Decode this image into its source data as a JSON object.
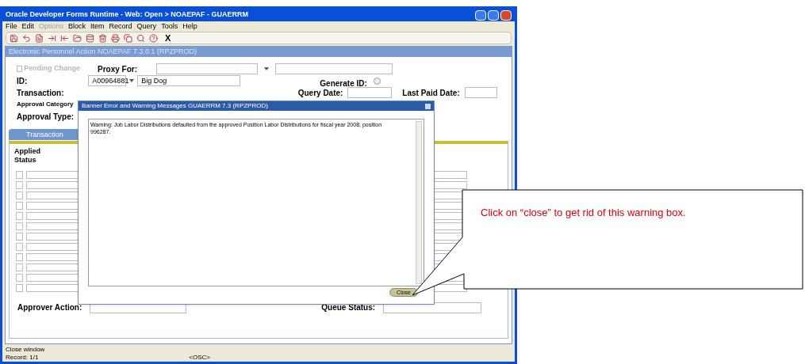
{
  "window": {
    "title": "Oracle Developer Forms Runtime - Web:  Open > NOAEPAF - GUAERRM"
  },
  "menu": [
    {
      "label": "File",
      "disabled": false
    },
    {
      "label": "Edit",
      "disabled": false
    },
    {
      "label": "Options",
      "disabled": true
    },
    {
      "label": "Block",
      "disabled": false
    },
    {
      "label": "Item",
      "disabled": false
    },
    {
      "label": "Record",
      "disabled": false
    },
    {
      "label": "Query",
      "disabled": false
    },
    {
      "label": "Tools",
      "disabled": false
    },
    {
      "label": "Help",
      "disabled": false
    }
  ],
  "toolbar": {
    "exit_label": "X"
  },
  "form": {
    "title": "Electronic Personnel Action  NOAEPAF  7.3.0.1  (RPZPROD)",
    "pending_change": {
      "label": "Pending Change",
      "checked": false,
      "disabled": true
    },
    "proxy_for": {
      "label": "Proxy For:"
    },
    "id": {
      "label": "ID:",
      "value": "A00964881",
      "name": "Big Dog"
    },
    "generate_id": {
      "label": "Generate ID:"
    },
    "transaction": {
      "label": "Transaction:"
    },
    "query_date": {
      "label": "Query Date:"
    },
    "last_paid_date": {
      "label": "Last Paid Date:"
    },
    "approval_category": {
      "label": "Approval Category"
    },
    "approval_type": {
      "label": "Approval Type:"
    },
    "tabs": [
      {
        "label": "Transaction",
        "selected": true
      }
    ],
    "grid": {
      "headers": [
        "Applied",
        "Status"
      ]
    },
    "approver_action": {
      "label": "Approver Action:"
    },
    "queue_status": {
      "label": "Queue Status:"
    }
  },
  "dialog": {
    "title": "Banner Error and Warning Messages  GUAERRM  7.3  (RPZPROD)",
    "message": "Warning: Job Labor Distributions defaulted from the approved Position Labor Distributions for fiscal year 2008, position 996287.",
    "button": "Close"
  },
  "status_bar": {
    "message": "Close window",
    "record": "Record: 1/1",
    "mode": "<OSC>"
  },
  "callout": {
    "text": "Click on “close” to get rid of this warning box."
  }
}
